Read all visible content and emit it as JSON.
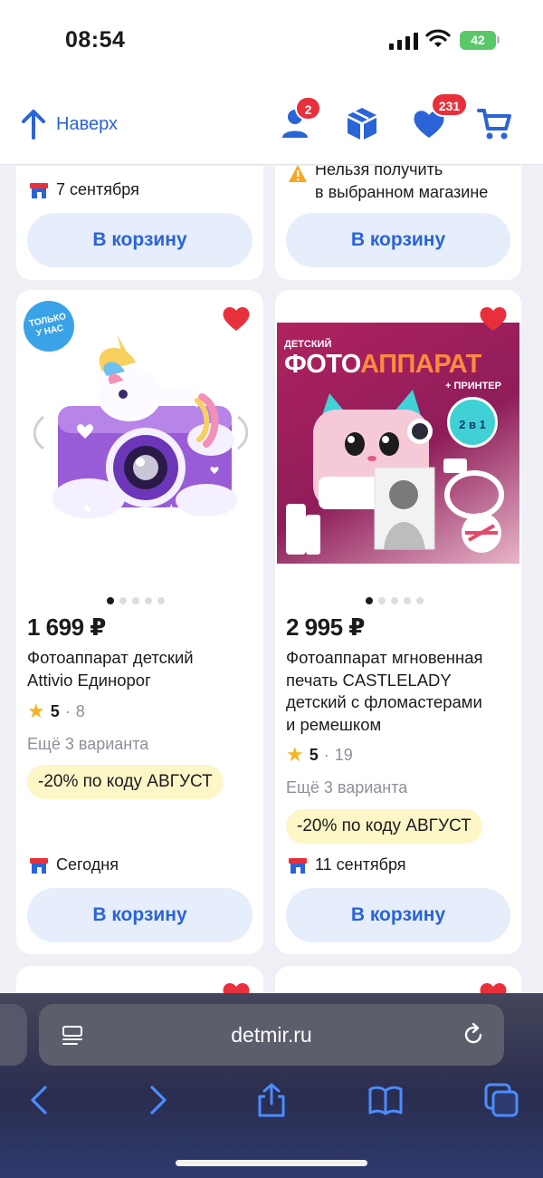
{
  "status_bar": {
    "time": "08:54",
    "battery": "42"
  },
  "top_bar": {
    "back_label": "Наверх",
    "profile_badge": "2",
    "favorites_badge": "231",
    "icons": [
      "arrow-up-icon",
      "profile-icon",
      "box-icon",
      "heart-icon",
      "cart-icon"
    ]
  },
  "prev_cards": [
    {
      "delivery": "7 сентября",
      "button": "В корзину"
    },
    {
      "warning": [
        "Нельзя получить",
        "в выбранном магазине"
      ],
      "button": "В корзину"
    }
  ],
  "products": [
    {
      "badge": [
        "ТОЛЬКО",
        "У НАС"
      ],
      "price": "1 699 ₽",
      "title": [
        "Фотоаппарат детский",
        "Attivio Единорог"
      ],
      "rating": "5",
      "reviews": "8",
      "variants": "Ещё 3 варианта",
      "promo": "-20% по коду АВГУСТ",
      "delivery": "Сегодня",
      "button": "В корзину"
    },
    {
      "image_text": {
        "small": "ДЕТСКИЙ",
        "big_white": "ФОТО",
        "big_orange": "АППАРАТ",
        "plus": "+ ПРИНТЕР",
        "in_one": "2 в 1"
      },
      "price": "2 995 ₽",
      "title": [
        "Фотоаппарат мгновенная",
        "печать CASTLELADY",
        "детский с фломастерами",
        "и ремешком"
      ],
      "rating": "5",
      "reviews": "19",
      "variants": "Ещё 3 варианта",
      "promo": "-20% по коду АВГУСТ",
      "delivery": "11 сентября",
      "button": "В корзину"
    }
  ],
  "browser": {
    "url": "detmir.ru",
    "toolbar": [
      "back-icon",
      "forward-icon",
      "share-icon",
      "bookmarks-icon",
      "tabs-icon"
    ]
  },
  "colors": {
    "accent": "#2a64d6",
    "badge": "#e8303c",
    "heart": "#e8303c",
    "promo_bg": "#fdf6c7",
    "button_bg": "#e6edfb"
  }
}
